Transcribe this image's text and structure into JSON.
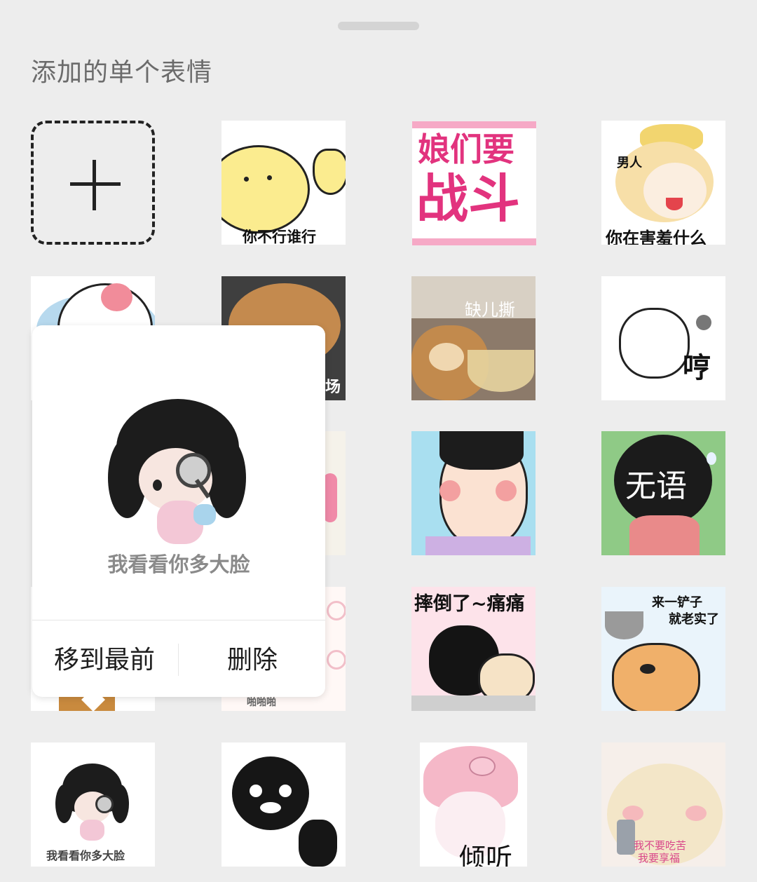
{
  "header": {
    "title": "添加的单个表情"
  },
  "grid": {
    "add_label": "+",
    "stickers": [
      {
        "caption": "你不行谁行"
      },
      {
        "caption_line1": "娘们要",
        "caption_line2": "战斗"
      },
      {
        "label_top": "男人",
        "caption": "你在害羞什么"
      },
      {
        "caption": ""
      },
      {
        "caption": "场"
      },
      {
        "caption": "缺儿撕"
      },
      {
        "caption": "哼"
      },
      {
        "caption": ""
      },
      {
        "caption": ""
      },
      {
        "caption": "无语"
      },
      {
        "caption": ""
      },
      {
        "caption": "啪啪啪"
      },
      {
        "caption": "摔倒了~痛痛"
      },
      {
        "caption_line1": "来一铲子",
        "caption_line2": "就老实了"
      },
      {
        "caption": "我看看你多大脸"
      },
      {
        "caption": ""
      },
      {
        "caption": "倾听"
      },
      {
        "caption_line1": "我不要吃苦",
        "caption_line2": "我要享福"
      }
    ]
  },
  "popup": {
    "preview_caption": "我看看你多大脸",
    "move_to_front": "移到最前",
    "delete": "删除"
  }
}
